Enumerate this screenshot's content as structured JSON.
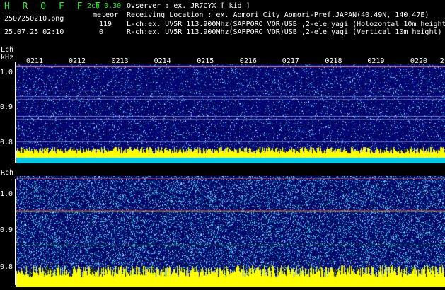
{
  "header": {
    "logo": "H R O F F T",
    "mode": "2ch 0.30",
    "category": "meteor",
    "filename": "2507250210.png",
    "datetime": "25.07.25 02:10",
    "lch_count": "119",
    "rch_count": "0",
    "observer_line": "Ovserver             : ex. JR7CYX [ kid ]",
    "location_line": "Receiving Location : ex. Aomori City Aomori-Pref.JAPAN(40.49N, 140.47E)",
    "lch_line": "L-ch:ex. UV5R 113.900Mhz(SAPPORO VOR)USB ,2-ele yagi (Holozontal 10m height",
    "rch_line": "R-ch:ex. UV5R 113.900Mhz(SAPPORO VOR)USB ,2-ele yagi (Vertical 10m height)"
  },
  "lch": {
    "label": "Lch",
    "unit": "kHz",
    "y_ticks": [
      "1.0",
      "0.9",
      "0.8"
    ],
    "time_ticks": [
      "0211",
      "0212",
      "0213",
      "0214",
      "0215",
      "0216",
      "0217",
      "0218",
      "0219",
      "0220"
    ],
    "trailing_tick": "2"
  },
  "rch": {
    "label": "Rch",
    "y_ticks": [
      "1.0",
      "0.9",
      "0.8"
    ]
  },
  "colors": {
    "header_green": "#37e43a",
    "background": "#000000",
    "spectrum_base": "#0a0a6e",
    "noise_bar": "#ffff00",
    "cyan_band": "#00c8e8"
  }
}
